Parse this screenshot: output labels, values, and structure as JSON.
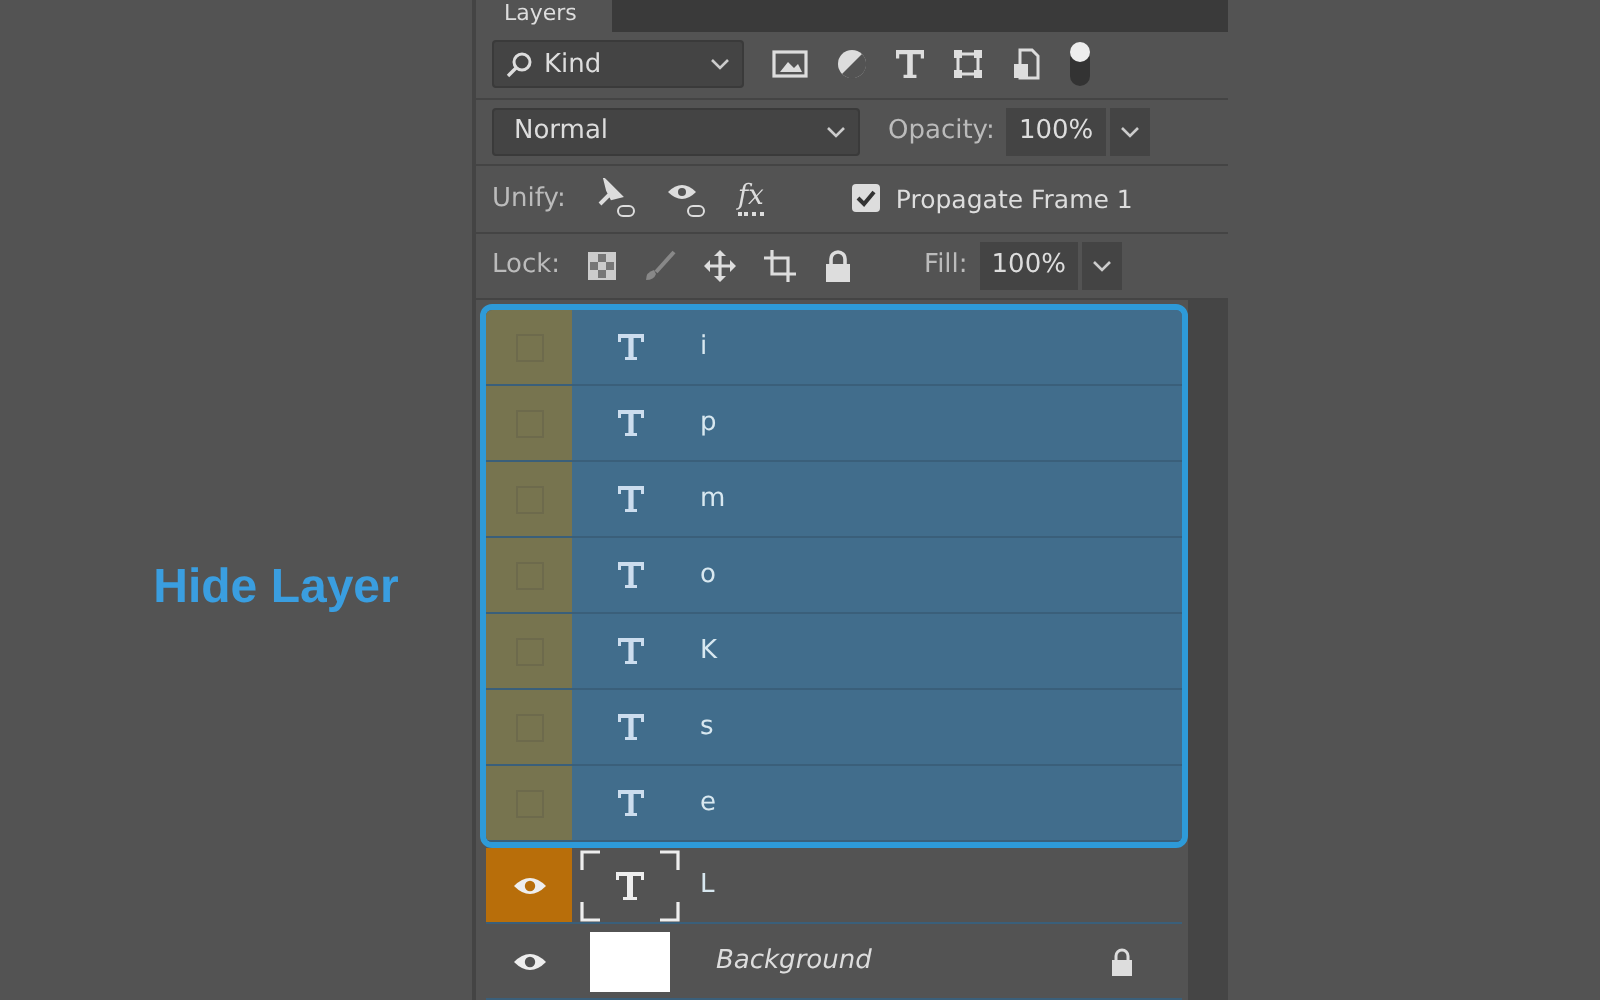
{
  "annotation": "Hide Layer",
  "panel": {
    "tab": "Layers",
    "filter": {
      "label": "Kind"
    },
    "blend": {
      "mode": "Normal",
      "opacity_label": "Opacity:",
      "opacity": "100%"
    },
    "unify": {
      "label": "Unify:",
      "propagate_label": "Propagate Frame 1",
      "style_icon": "fx",
      "propagate_checked": true
    },
    "lock": {
      "label": "Lock:",
      "fill_label": "Fill:",
      "fill": "100%"
    },
    "layers": [
      {
        "name": "i",
        "kind": "text",
        "visible": false,
        "selected": true,
        "eye_active": false,
        "locked": false
      },
      {
        "name": "p",
        "kind": "text",
        "visible": false,
        "selected": true,
        "eye_active": false,
        "locked": false
      },
      {
        "name": "m",
        "kind": "text",
        "visible": false,
        "selected": true,
        "eye_active": false,
        "locked": false
      },
      {
        "name": "o",
        "kind": "text",
        "visible": false,
        "selected": true,
        "eye_active": false,
        "locked": false
      },
      {
        "name": "K",
        "kind": "text",
        "visible": false,
        "selected": true,
        "eye_active": false,
        "locked": false
      },
      {
        "name": "s",
        "kind": "text",
        "visible": false,
        "selected": true,
        "eye_active": false,
        "locked": false
      },
      {
        "name": "e",
        "kind": "text",
        "visible": false,
        "selected": true,
        "eye_active": false,
        "locked": false
      },
      {
        "name": "L",
        "kind": "text-frame",
        "visible": true,
        "selected": false,
        "eye_active": true,
        "locked": false
      },
      {
        "name": "Background",
        "kind": "fill",
        "visible": true,
        "selected": false,
        "eye_active": false,
        "locked": true
      }
    ]
  }
}
